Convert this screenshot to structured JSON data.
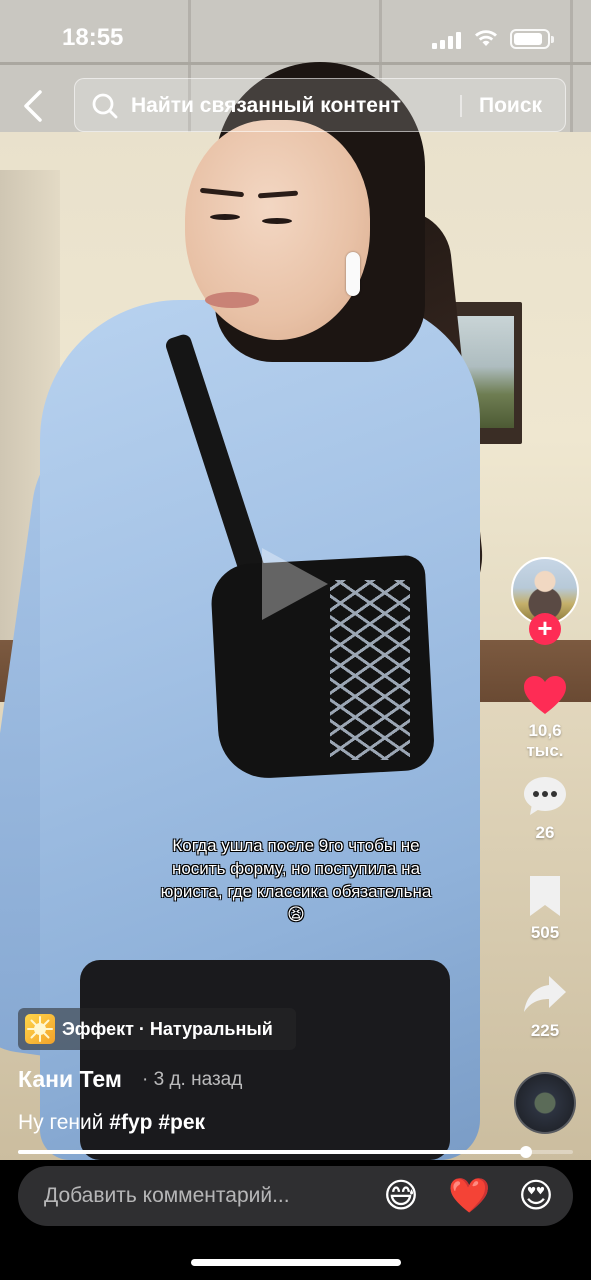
{
  "status_bar": {
    "time": "18:55"
  },
  "search": {
    "placeholder": "Найти связанный контент",
    "button_label": "Поиск"
  },
  "video": {
    "caption_overlay": "Когда ушла после 9го чтобы не носить форму, но поступила на юриста, где классика обязательна😫",
    "progress_fraction": 0.915
  },
  "actions": {
    "likes": "10,6 тыс.",
    "comments": "26",
    "saves": "505",
    "shares": "225",
    "like_color": "#fe2c55",
    "follow_symbol": "+"
  },
  "effect": {
    "label": "Эффект · Натуральный"
  },
  "post": {
    "author": "Кани Тем",
    "time_ago": "· 3 д. назад",
    "description_text": "Ну гений",
    "hashtags": [
      "#fyp",
      "#рек"
    ]
  },
  "comment_bar": {
    "placeholder": "Добавить комментарий...",
    "quick_emojis": [
      "😅",
      "❤️",
      "😍"
    ]
  }
}
